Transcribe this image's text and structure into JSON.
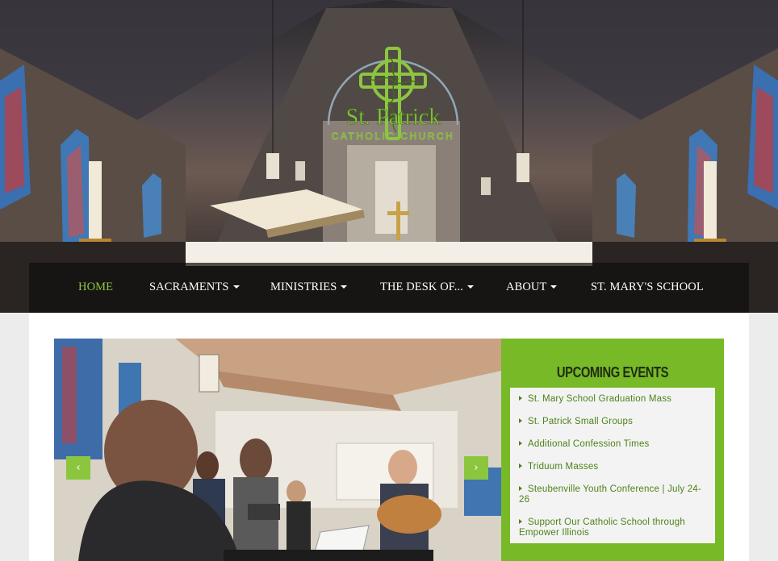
{
  "logo": {
    "name_line1": "St. Patrick",
    "name_line2": "CATHOLIC CHURCH",
    "icon": "celtic-cross-icon"
  },
  "nav": {
    "items": [
      {
        "label": "HOME",
        "active": true,
        "dropdown": false
      },
      {
        "label": "SACRAMENTS",
        "active": false,
        "dropdown": true
      },
      {
        "label": "MINISTRIES",
        "active": false,
        "dropdown": true
      },
      {
        "label": "THE DESK OF...",
        "active": false,
        "dropdown": true
      },
      {
        "label": "ABOUT",
        "active": false,
        "dropdown": true
      },
      {
        "label": "ST. MARY'S SCHOOL",
        "active": false,
        "dropdown": false
      }
    ]
  },
  "slider": {
    "prev_label": "‹",
    "next_label": "›"
  },
  "events": {
    "title": "UPCOMING EVENTS",
    "items": [
      "St. Mary School Graduation Mass",
      "St. Patrick Small Groups",
      "Additional Confession Times",
      "Triduum Masses",
      "Steubenville Youth Conference | July 24-26",
      "Support Our Catholic School through Empower Illinois"
    ]
  },
  "colors": {
    "accent_green": "#8cc63f",
    "panel_green": "#78b928",
    "link_green": "#4e8219",
    "nav_bg": "#0f0f0f"
  }
}
